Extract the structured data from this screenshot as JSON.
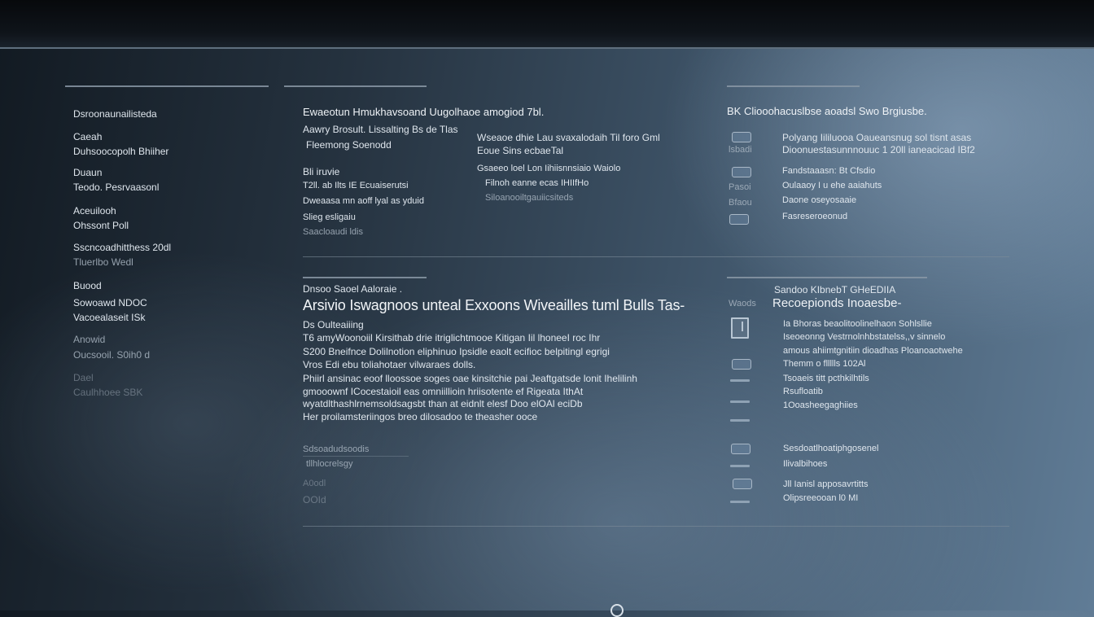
{
  "sidebar": {
    "items": [
      {
        "label": "Dsroonaunailisteda"
      },
      {
        "label": "Caeah"
      },
      {
        "label": "Duhsoocopolh Bhiiher"
      },
      {
        "label": "Duaun"
      },
      {
        "label": "Teodo. Pesrvaasonl"
      },
      {
        "label": "Aceuilooh"
      },
      {
        "label": "Ohssont Poll"
      },
      {
        "label": "Sscncoadhitthess 20dl"
      },
      {
        "label": "Tluerlbo Wedl"
      },
      {
        "label": "Buood"
      },
      {
        "label": "Sowoawd NDOC"
      },
      {
        "label": "Vacoealaseit ISk"
      },
      {
        "label": "Anowid"
      },
      {
        "label": "Oucsooil. S0ih0 d"
      },
      {
        "label": "Dael"
      },
      {
        "label": "Caulhhoee SBK"
      }
    ]
  },
  "col1": {
    "heading": "Ewaeotun Hmukhavsoand Uugolhaoe amogiod 7bl.",
    "lines": [
      "Aawry Brosult. Lissalting Bs de Tlas",
      "Fleemong Soenodd",
      "Bli iruvie",
      "T2ll. ab Ilts IE Ecuaiserutsi",
      "Dweaasa mn aoff lyal as yduid",
      "Slieg esligaiu",
      "Saacloaudi ldis"
    ]
  },
  "col2": {
    "lines": [
      "Wseaoe dhie Lau svaxalodaih Til foro Gml",
      "Eoue Sins ecbaeTal",
      "Gsaeeo loel Lon Iihiisnnsiaio Waiolo",
      "Filnoh eanne ecas IHIIfHo",
      "Siloanooiltgauiicsiteds"
    ]
  },
  "col3": {
    "heading": "BK Cliooohacuslbse aoadsl Swo Brgiusbe.",
    "rows": [
      {
        "title": "Polyang Iililuooa Oaueansnug sol tisnt asas",
        "sub": "Dioonuestasunnnouuc 1 20ll ianeacicad IBf2",
        "icon_caption": "lsbadi"
      },
      {
        "title": "Fandstaaasn: Bt Cfsdio",
        "sub": "Oulaaoy I u ehe aaiahuts",
        "icon_caption": "Pasoi"
      },
      {
        "title": "Daone oseyosaaie",
        "sub": "",
        "icon_caption": "Bfaou"
      },
      {
        "title": "Fasreseroeonud",
        "sub": "",
        "icon_caption": ""
      }
    ]
  },
  "lower_left": {
    "section_label": "Dnsoo Saoel Aaloraie .",
    "headline": "Arsivio Iswagnoos unteal Exxoons Wiveailles tuml Bulls Tas-",
    "sub_label": "Ds Oulteaiiing",
    "paragraph": [
      "T6 amyWoonoiil Kirsithab drie itriglichtmooe Kitigan Iil lhoneeI roc Ihr",
      "S200 Bneifnce Dolilnotion eliphinuo Ipsidle eaolt ecifioc belpitingl egrigi",
      "Vros Edi ebu toliahotaer vilwaraes dolls.",
      "Phiirl ansinac eoof lloossoe soges oae kinsitchie pai Jeaftgatsde lonit Ihelilinh",
      "gmooownf ICocestaioil eas omniillioin hriisotente ef Rigeata IthAt",
      "wyatdlthashlrnemsoldsagsbt than at eidnlt elesf Doo elOAl eciDb",
      "Her proilamsteriingos breo dilosadoo te theasher ooce"
    ],
    "footer_items": [
      {
        "label": "Sdsoadudsoodis"
      },
      {
        "label": "tllhlocrelsgy"
      },
      {
        "label": "A0odl"
      },
      {
        "label": "OOId"
      }
    ]
  },
  "lower_right": {
    "prefix": "Waods",
    "heading": "Sandoo KIbnebT GHeEDIIA",
    "subheading": "Recoepionds Inoaesbe-",
    "block": [
      "Ia Bhoras beaolitoolinelhaon Sohlsllie",
      "Iseoeonng Vestrnolnhbstatelss,,v sinnelo",
      "amous ahiimtgnitiin dioadhas Ploanoaotwehe",
      "Themm o fllllls 102Al",
      "Tsoaeis titt pcthkilhtils",
      "Rsufloatib",
      "1Ooasheegaghiies"
    ],
    "footer": [
      {
        "title": "Sesdoatlhoatiphgosenel",
        "sub": "Ilivalbihoes"
      },
      {
        "title": "Jll Ianisl apposavrtitts",
        "sub": "Olipsreeooan l0 MI"
      }
    ]
  },
  "colors": {
    "topbar": "#0b0f13",
    "accent": "#8a98a6",
    "text": "#dfe6ed"
  }
}
